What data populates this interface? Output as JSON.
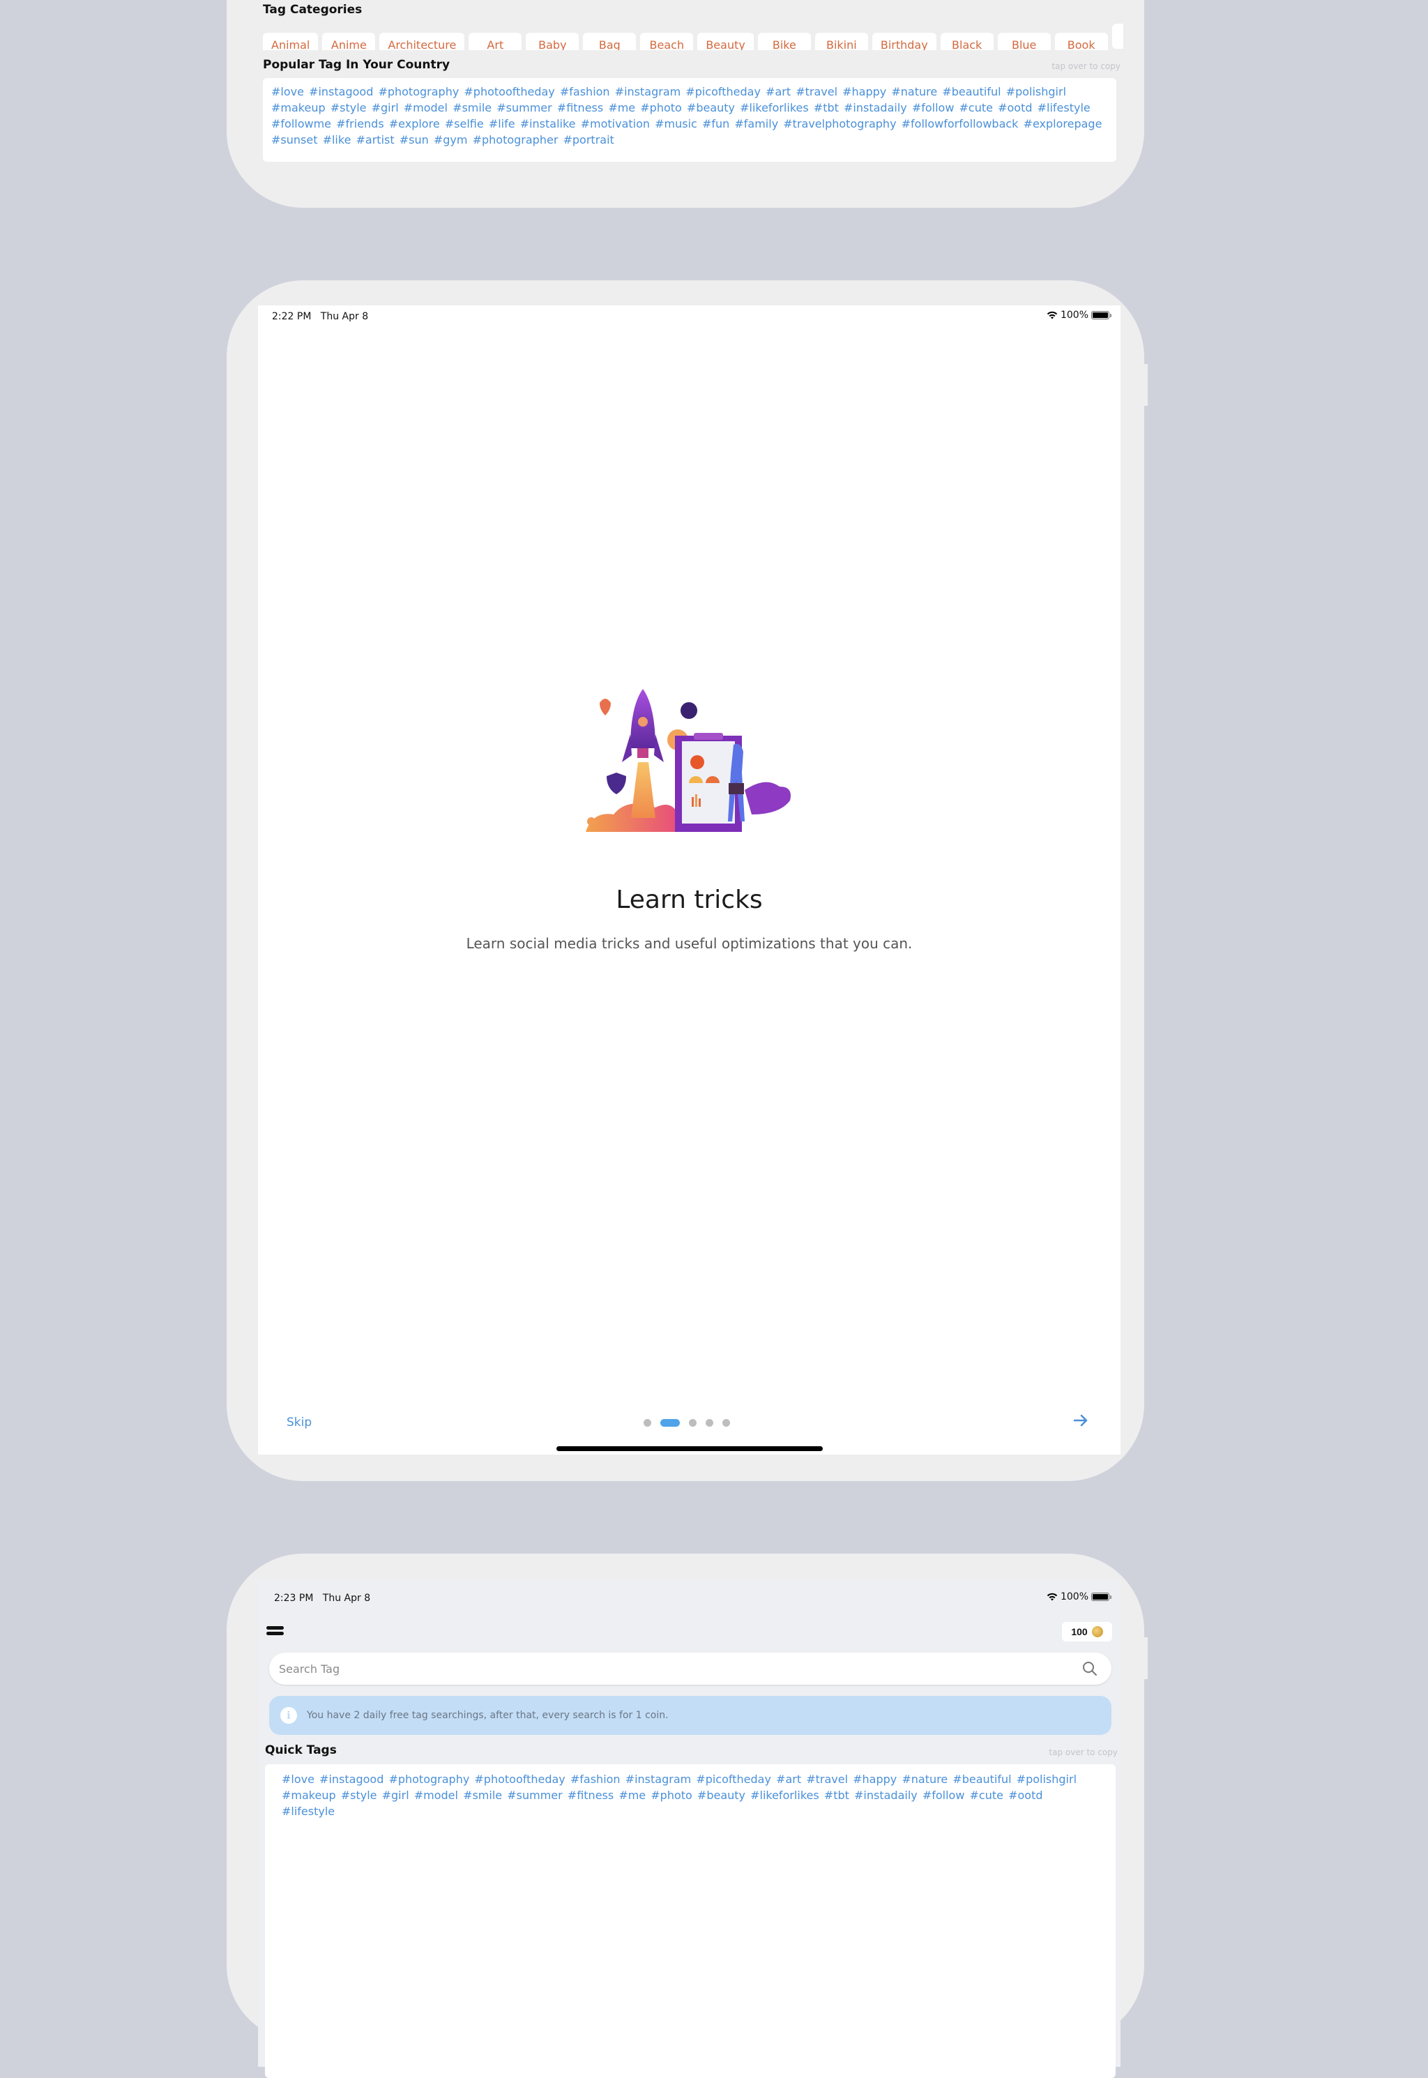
{
  "screen1": {
    "categories_title": "Tag Categories",
    "categories": [
      "Animal",
      "Anime",
      "Architecture",
      "Art",
      "Baby",
      "Bag",
      "Beach",
      "Beauty",
      "Bike",
      "Bikini",
      "Birthday",
      "Black",
      "Blue",
      "Book",
      ""
    ],
    "popular_title": "Popular Tag In Your Country",
    "copy_hint": "tap over to copy",
    "popular_tags": [
      "#love",
      "#instagood",
      "#photography",
      "#photooftheday",
      "#fashion",
      "#instagram",
      "#picoftheday",
      "#art",
      "#travel",
      "#happy",
      "#nature",
      "#beautiful",
      "#polishgirl",
      "#makeup",
      "#style",
      "#girl",
      "#model",
      "#smile",
      "#summer",
      "#fitness",
      "#me",
      "#photo",
      "#beauty",
      "#likeforlikes",
      "#tbt",
      "#instadaily",
      "#follow",
      "#cute",
      "#ootd",
      "#lifestyle",
      "#followme",
      "#friends",
      "#explore",
      "#selfie",
      "#life",
      "#instalike",
      "#motivation",
      "#music",
      "#fun",
      "#family",
      "#travelphotography",
      "#followforfollowback",
      "#explorepage",
      "#sunset",
      "#like",
      "#artist",
      "#sun",
      "#gym",
      "#photographer",
      "#portrait"
    ]
  },
  "screen2": {
    "status": {
      "time": "2:22 PM",
      "date": "Thu Apr 8",
      "battery": "100%"
    },
    "illustration": "rocket-launch-analytics-illustration",
    "title": "Learn tricks",
    "description": "Learn social media tricks and useful optimizations that you can.",
    "skip_label": "Skip",
    "page_count": 5,
    "active_page": 2,
    "next_icon": "arrow-right-icon"
  },
  "screen3": {
    "status": {
      "time": "2:23 PM",
      "date": "Thu Apr 8",
      "battery": "100%"
    },
    "coin_balance": "100",
    "search_placeholder": "Search Tag",
    "search_value": "",
    "info_text": "You have 2 daily free tag searchings, after that, every search is for 1 coin.",
    "info_icon_glyph": "i",
    "quick_tags_title": "Quick Tags",
    "copy_hint": "tap over to copy",
    "quick_tags": [
      "#love",
      "#instagood",
      "#photography",
      "#photooftheday",
      "#fashion",
      "#instagram",
      "#picoftheday",
      "#art",
      "#travel",
      "#happy",
      "#nature",
      "#beautiful",
      "#polishgirl",
      "#makeup",
      "#style",
      "#girl",
      "#model",
      "#smile",
      "#summer",
      "#fitness",
      "#me",
      "#photo",
      "#beauty",
      "#likeforlikes",
      "#tbt",
      "#instadaily",
      "#follow",
      "#cute",
      "#ootd",
      "#lifestyle"
    ]
  },
  "colors": {
    "accent_blue": "#4a90d9",
    "category_orange": "#d4693e",
    "info_bg": "#c3ddf6",
    "dot_active": "#4ea3e9",
    "backdrop": "#cfd2db"
  }
}
